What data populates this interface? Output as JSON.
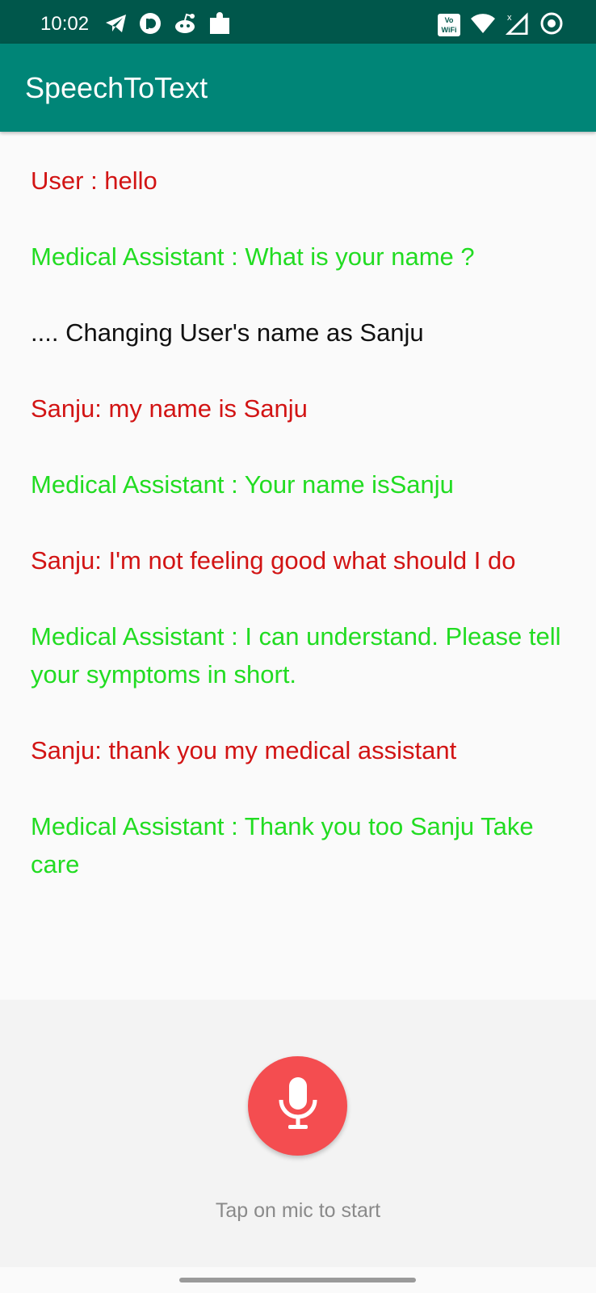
{
  "status_bar": {
    "time": "10:02",
    "left_icons": [
      "telegram-icon",
      "pocket-casts-icon",
      "reddit-icon",
      "puzzle-icon"
    ],
    "right_icons": [
      "vowifi-icon",
      "wifi-icon",
      "mobile-signal-icon",
      "sync-icon"
    ],
    "volte_line1": "Vo",
    "volte_line2": "WiFi"
  },
  "app_bar": {
    "title": "SpeechToText",
    "background_color": "#008577"
  },
  "colors": {
    "user": "#d21414",
    "assistant": "#22dc22",
    "system": "#111111",
    "mic": "#f44d50"
  },
  "conversation": {
    "messages": [
      {
        "role": "user",
        "text": "User : hello"
      },
      {
        "role": "assistant",
        "text": "Medical Assistant : What is your name ?"
      },
      {
        "role": "system",
        "text": ".... Changing User's name as Sanju"
      },
      {
        "role": "user",
        "text": "Sanju: my name is Sanju"
      },
      {
        "role": "assistant",
        "text": "Medical Assistant : Your name isSanju"
      },
      {
        "role": "user",
        "text": "Sanju: I'm not feeling good what should I do"
      },
      {
        "role": "assistant",
        "text": "Medical Assistant : I can understand. Please tell your symptoms in short."
      },
      {
        "role": "user",
        "text": "Sanju: thank you my medical assistant"
      },
      {
        "role": "assistant",
        "text": "Medical Assistant : Thank you too Sanju Take care"
      }
    ]
  },
  "mic": {
    "icon": "microphone-icon",
    "hint": "Tap on mic to start"
  }
}
